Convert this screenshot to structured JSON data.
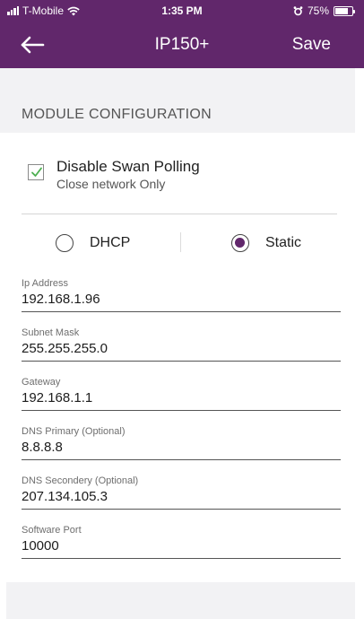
{
  "status_bar": {
    "carrier": "T-Mobile",
    "time": "1:35 PM",
    "battery_percent": "75%",
    "battery_level": 0.75
  },
  "navbar": {
    "back_icon": "arrow-left-icon",
    "title": "IP150+",
    "save_label": "Save"
  },
  "section": {
    "title": "MODULE CONFIGURATION"
  },
  "polling": {
    "label": "Disable Swan Polling",
    "sublabel": "Close network Only",
    "checked": true
  },
  "ip_mode": {
    "options": [
      "DHCP",
      "Static"
    ],
    "selected": "Static"
  },
  "fields": [
    {
      "label": "Ip Address",
      "value": "192.168.1.96"
    },
    {
      "label": "Subnet Mask",
      "value": "255.255.255.0"
    },
    {
      "label": "Gateway",
      "value": "192.168.1.1"
    },
    {
      "label": "DNS Primary (Optional)",
      "value": "8.8.8.8"
    },
    {
      "label": "DNS Secondery (Optional)",
      "value": "207.134.105.3"
    },
    {
      "label": "Software Port",
      "value": "10000"
    }
  ],
  "colors": {
    "header": "#61276b",
    "section_bg": "#f2f2f4",
    "checkbox_mark": "#4caf50"
  }
}
